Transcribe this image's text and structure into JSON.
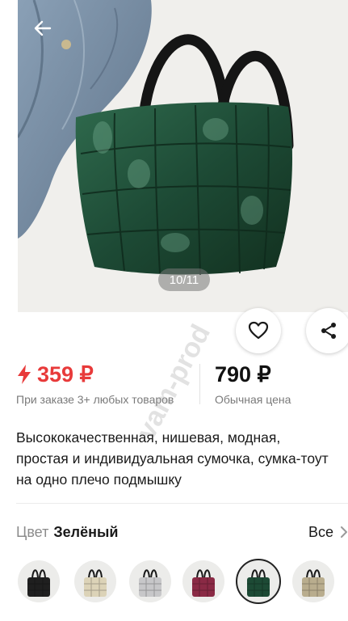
{
  "gallery": {
    "counter": "10/11",
    "watermark": "vam-prod",
    "current_index": 10,
    "total": 11
  },
  "price": {
    "sale": "359 ₽",
    "sale_note": "При заказе 3+ любых товаров",
    "regular": "790 ₽",
    "regular_note": "Обычная цена"
  },
  "description": "Высококачественная, нишевая, модная, простая и индивидуальная сумочка, сумка-тоут на одно плечо подмышку",
  "color": {
    "label": "Цвет",
    "value": "Зелёный",
    "see_all": "Все"
  },
  "swatches": [
    {
      "name": "black",
      "hex": "#1f1f1f"
    },
    {
      "name": "beige",
      "hex": "#dcd3b8"
    },
    {
      "name": "silver",
      "hex": "#c7c7c9"
    },
    {
      "name": "burgundy",
      "hex": "#8a2a45"
    },
    {
      "name": "green",
      "hex": "#1d4a35",
      "selected": true
    },
    {
      "name": "khaki",
      "hex": "#b9ad8e"
    }
  ],
  "colors": {
    "accent_red": "#e83a3a",
    "bag_green": "#1d4a35"
  }
}
